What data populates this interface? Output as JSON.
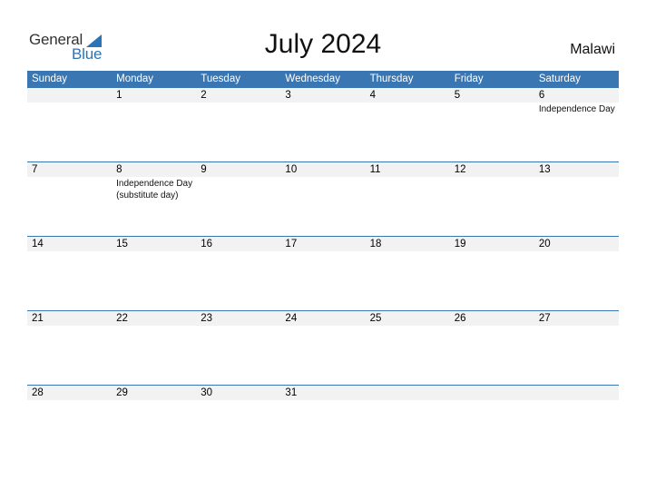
{
  "logo": {
    "part1": "General",
    "part2": "Blue",
    "icon": "triangle-logo-icon"
  },
  "title": "July 2024",
  "country": "Malawi",
  "colors": {
    "header_bg": "#3a76b2",
    "logo_blue": "#2a74b8",
    "daynum_bg": "#f2f2f2"
  },
  "weekdays": [
    "Sunday",
    "Monday",
    "Tuesday",
    "Wednesday",
    "Thursday",
    "Friday",
    "Saturday"
  ],
  "weeks": [
    {
      "days": [
        {
          "num": "",
          "event": ""
        },
        {
          "num": "1",
          "event": ""
        },
        {
          "num": "2",
          "event": ""
        },
        {
          "num": "3",
          "event": ""
        },
        {
          "num": "4",
          "event": ""
        },
        {
          "num": "5",
          "event": ""
        },
        {
          "num": "6",
          "event": "Independence Day"
        }
      ]
    },
    {
      "days": [
        {
          "num": "7",
          "event": ""
        },
        {
          "num": "8",
          "event": "Independence Day (substitute day)"
        },
        {
          "num": "9",
          "event": ""
        },
        {
          "num": "10",
          "event": ""
        },
        {
          "num": "11",
          "event": ""
        },
        {
          "num": "12",
          "event": ""
        },
        {
          "num": "13",
          "event": ""
        }
      ]
    },
    {
      "days": [
        {
          "num": "14",
          "event": ""
        },
        {
          "num": "15",
          "event": ""
        },
        {
          "num": "16",
          "event": ""
        },
        {
          "num": "17",
          "event": ""
        },
        {
          "num": "18",
          "event": ""
        },
        {
          "num": "19",
          "event": ""
        },
        {
          "num": "20",
          "event": ""
        }
      ]
    },
    {
      "days": [
        {
          "num": "21",
          "event": ""
        },
        {
          "num": "22",
          "event": ""
        },
        {
          "num": "23",
          "event": ""
        },
        {
          "num": "24",
          "event": ""
        },
        {
          "num": "25",
          "event": ""
        },
        {
          "num": "26",
          "event": ""
        },
        {
          "num": "27",
          "event": ""
        }
      ]
    },
    {
      "days": [
        {
          "num": "28",
          "event": ""
        },
        {
          "num": "29",
          "event": ""
        },
        {
          "num": "30",
          "event": ""
        },
        {
          "num": "31",
          "event": ""
        },
        {
          "num": "",
          "event": ""
        },
        {
          "num": "",
          "event": ""
        },
        {
          "num": "",
          "event": ""
        }
      ]
    }
  ]
}
